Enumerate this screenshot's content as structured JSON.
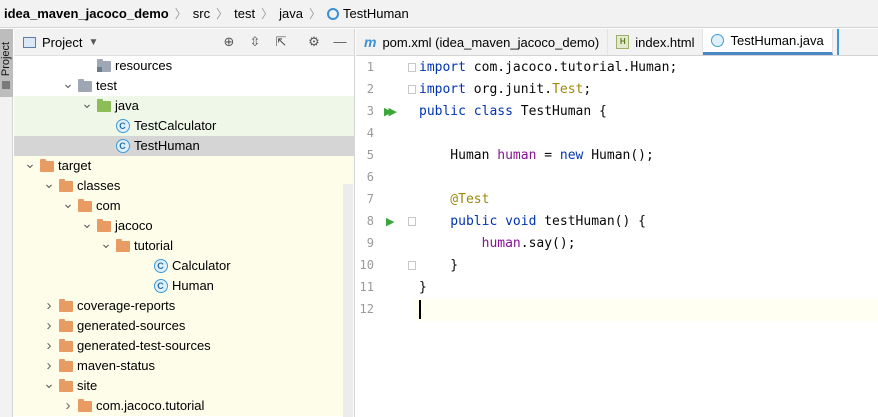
{
  "breadcrumb": {
    "project": "idea_maven_jacoco_demo",
    "items": [
      "src",
      "test",
      "java",
      "TestHuman"
    ]
  },
  "toolstrip": {
    "label": "Project"
  },
  "project_panel": {
    "title": "Project",
    "tree": [
      {
        "label": "resources",
        "depth": 4,
        "icon": "folder-resources",
        "expanded": null,
        "bg": "none"
      },
      {
        "label": "test",
        "depth": 3,
        "icon": "folder-gray",
        "expanded": true,
        "bg": "none"
      },
      {
        "label": "java",
        "depth": 4,
        "icon": "folder-green",
        "expanded": true,
        "bg": "green"
      },
      {
        "label": "TestCalculator",
        "depth": 5,
        "icon": "class-icon",
        "expanded": null,
        "bg": "green"
      },
      {
        "label": "TestHuman",
        "depth": 5,
        "icon": "class-icon",
        "expanded": null,
        "bg": "selected"
      },
      {
        "label": "target",
        "depth": 1,
        "icon": "folder-orange",
        "expanded": true,
        "bg": "yellow"
      },
      {
        "label": "classes",
        "depth": 2,
        "icon": "folder-orange",
        "expanded": true,
        "bg": "yellow"
      },
      {
        "label": "com",
        "depth": 3,
        "icon": "folder-orange",
        "expanded": true,
        "bg": "yellow"
      },
      {
        "label": "jacoco",
        "depth": 4,
        "icon": "folder-orange",
        "expanded": true,
        "bg": "yellow"
      },
      {
        "label": "tutorial",
        "depth": 5,
        "icon": "folder-orange",
        "expanded": true,
        "bg": "yellow"
      },
      {
        "label": "Calculator",
        "depth": 7,
        "icon": "class-icon",
        "expanded": null,
        "bg": "yellow"
      },
      {
        "label": "Human",
        "depth": 7,
        "icon": "class-icon",
        "expanded": null,
        "bg": "yellow"
      },
      {
        "label": "coverage-reports",
        "depth": 2,
        "icon": "folder-orange",
        "expanded": false,
        "bg": "yellow"
      },
      {
        "label": "generated-sources",
        "depth": 2,
        "icon": "folder-orange",
        "expanded": false,
        "bg": "yellow"
      },
      {
        "label": "generated-test-sources",
        "depth": 2,
        "icon": "folder-orange",
        "expanded": false,
        "bg": "yellow"
      },
      {
        "label": "maven-status",
        "depth": 2,
        "icon": "folder-orange",
        "expanded": false,
        "bg": "yellow"
      },
      {
        "label": "site",
        "depth": 2,
        "icon": "folder-orange",
        "expanded": true,
        "bg": "yellow"
      },
      {
        "label": "com.jacoco.tutorial",
        "depth": 3,
        "icon": "folder-orange",
        "expanded": false,
        "bg": "yellow"
      }
    ]
  },
  "tabs": [
    {
      "label": "pom.xml (idea_maven_jacoco_demo)",
      "icon": "maven-icon",
      "active": false
    },
    {
      "label": "index.html",
      "icon": "html-icon",
      "active": false
    },
    {
      "label": "TestHuman.java",
      "icon": "class-icon",
      "active": true
    }
  ],
  "editor": {
    "lines": [
      {
        "n": "1",
        "tokens": [
          [
            "kw",
            "import"
          ],
          [
            "plain",
            " com.jacoco.tutorial.Human;"
          ]
        ]
      },
      {
        "n": "2",
        "tokens": [
          [
            "kw",
            "import"
          ],
          [
            "plain",
            " org.junit."
          ],
          [
            "ann",
            "Test"
          ],
          [
            "plain",
            ";"
          ]
        ]
      },
      {
        "n": "3",
        "tokens": [
          [
            "kw",
            "public class"
          ],
          [
            "plain",
            " TestHuman {"
          ]
        ]
      },
      {
        "n": "4",
        "tokens": []
      },
      {
        "n": "5",
        "tokens": [
          [
            "plain",
            "    Human "
          ],
          [
            "field",
            "human"
          ],
          [
            "plain",
            " = "
          ],
          [
            "kw",
            "new"
          ],
          [
            "plain",
            " Human();"
          ]
        ]
      },
      {
        "n": "6",
        "tokens": []
      },
      {
        "n": "7",
        "tokens": [
          [
            "ann",
            "    @Test"
          ]
        ]
      },
      {
        "n": "8",
        "tokens": [
          [
            "kw",
            "    public void"
          ],
          [
            "plain",
            " testHuman() {"
          ]
        ]
      },
      {
        "n": "9",
        "tokens": [
          [
            "field",
            "        human"
          ],
          [
            "plain",
            ".say();"
          ]
        ]
      },
      {
        "n": "10",
        "tokens": [
          [
            "plain",
            "    }"
          ]
        ]
      },
      {
        "n": "11",
        "tokens": [
          [
            "plain",
            "}"
          ]
        ]
      },
      {
        "n": "12",
        "tokens": []
      }
    ]
  }
}
